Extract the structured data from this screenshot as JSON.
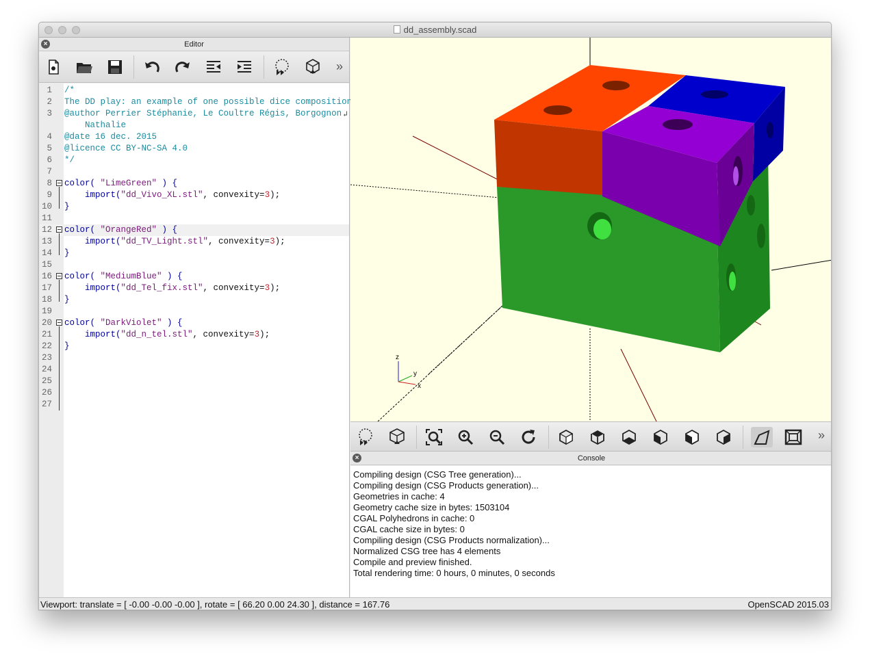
{
  "window": {
    "title": "dd_assembly.scad"
  },
  "editor": {
    "header": "Editor",
    "toolbar_icons": [
      "new-file-icon",
      "open-folder-icon",
      "save-icon",
      "undo-icon",
      "redo-icon",
      "unindent-icon",
      "indent-icon",
      "preview-icon",
      "render-icon",
      "more-icon"
    ],
    "lines": [
      {
        "n": "1",
        "segments": [
          {
            "t": "/*",
            "c": "comment"
          }
        ]
      },
      {
        "n": "2",
        "segments": [
          {
            "t": "The DD play: an example of one possible dice composition",
            "c": "comment"
          }
        ]
      },
      {
        "n": "3",
        "segments": [
          {
            "t": "@author Perrier Stéphanie, Le Coultre Régis, Borgognon",
            "c": "comment"
          }
        ]
      },
      {
        "n": "",
        "segments": [
          {
            "t": "    Nathalie",
            "c": "comment"
          }
        ]
      },
      {
        "n": "4",
        "segments": [
          {
            "t": "@date 16 dec. 2015",
            "c": "comment"
          }
        ]
      },
      {
        "n": "5",
        "segments": [
          {
            "t": "@licence CC BY-NC-SA 4.0",
            "c": "comment"
          }
        ]
      },
      {
        "n": "6",
        "segments": [
          {
            "t": "*/",
            "c": "comment"
          }
        ]
      },
      {
        "n": "7",
        "segments": []
      },
      {
        "n": "8",
        "fold": true,
        "segments": [
          {
            "t": "color( ",
            "c": "kw"
          },
          {
            "t": "\"LimeGreen\"",
            "c": "str"
          },
          {
            "t": " ) {",
            "c": "kw"
          }
        ]
      },
      {
        "n": "9",
        "segments": [
          {
            "t": "    import(",
            "c": "kw"
          },
          {
            "t": "\"dd_Vivo_XL.stl\"",
            "c": "str"
          },
          {
            "t": ", convexity=",
            "c": "plain"
          },
          {
            "t": "3",
            "c": "num"
          },
          {
            "t": ");",
            "c": "plain"
          }
        ]
      },
      {
        "n": "10",
        "segments": [
          {
            "t": "}",
            "c": "kw"
          }
        ]
      },
      {
        "n": "11",
        "segments": []
      },
      {
        "n": "12",
        "fold": true,
        "hl": true,
        "segments": [
          {
            "t": "color( ",
            "c": "kw"
          },
          {
            "t": "\"OrangeRed\"",
            "c": "str"
          },
          {
            "t": " ) {",
            "c": "kw"
          }
        ]
      },
      {
        "n": "13",
        "segments": [
          {
            "t": "    import(",
            "c": "kw"
          },
          {
            "t": "\"dd_TV_Light.stl\"",
            "c": "str"
          },
          {
            "t": ", convexity=",
            "c": "plain"
          },
          {
            "t": "3",
            "c": "num"
          },
          {
            "t": ");",
            "c": "plain"
          }
        ]
      },
      {
        "n": "14",
        "segments": [
          {
            "t": "}",
            "c": "kw"
          }
        ]
      },
      {
        "n": "15",
        "segments": []
      },
      {
        "n": "16",
        "fold": true,
        "segments": [
          {
            "t": "color( ",
            "c": "kw"
          },
          {
            "t": "\"MediumBlue\"",
            "c": "str"
          },
          {
            "t": " ) {",
            "c": "kw"
          }
        ]
      },
      {
        "n": "17",
        "segments": [
          {
            "t": "    import(",
            "c": "kw"
          },
          {
            "t": "\"dd_Tel_fix.stl\"",
            "c": "str"
          },
          {
            "t": ", convexity=",
            "c": "plain"
          },
          {
            "t": "3",
            "c": "num"
          },
          {
            "t": ");",
            "c": "plain"
          }
        ]
      },
      {
        "n": "18",
        "segments": [
          {
            "t": "}",
            "c": "kw"
          }
        ]
      },
      {
        "n": "19",
        "segments": []
      },
      {
        "n": "20",
        "fold": true,
        "segments": [
          {
            "t": "color( ",
            "c": "kw"
          },
          {
            "t": "\"DarkViolet\"",
            "c": "str"
          },
          {
            "t": " ) {",
            "c": "kw"
          }
        ]
      },
      {
        "n": "21",
        "segments": [
          {
            "t": "    import(",
            "c": "kw"
          },
          {
            "t": "\"dd_n_tel.stl\"",
            "c": "str"
          },
          {
            "t": ", convexity=",
            "c": "plain"
          },
          {
            "t": "3",
            "c": "num"
          },
          {
            "t": ");",
            "c": "plain"
          }
        ]
      },
      {
        "n": "22",
        "segments": [
          {
            "t": "}",
            "c": "kw"
          }
        ]
      },
      {
        "n": "23",
        "segments": []
      },
      {
        "n": "24",
        "segments": []
      },
      {
        "n": "25",
        "segments": []
      },
      {
        "n": "26",
        "segments": []
      },
      {
        "n": "27",
        "segments": []
      }
    ]
  },
  "viewport": {
    "background": "#ffffe5",
    "axis_labels": {
      "z": "z",
      "y": "y",
      "x": "x"
    },
    "colors": {
      "green": "#2a992a",
      "orange_red": "#ff4500",
      "medium_blue": "#0000cd",
      "dark_violet": "#9400d3"
    }
  },
  "view_toolbar_icons": [
    "preview-icon",
    "render-icon",
    "view-all-icon",
    "zoom-in-icon",
    "zoom-out-icon",
    "reset-view-icon",
    "view-right-icon",
    "view-top-icon",
    "view-bottom-icon",
    "view-left-icon",
    "view-front-icon",
    "view-back-icon",
    "perspective-icon",
    "orthogonal-icon",
    "more-icon"
  ],
  "console": {
    "header": "Console",
    "lines": [
      "Compiling design (CSG Tree generation)...",
      "Compiling design (CSG Products generation)...",
      "Geometries in cache: 4",
      "Geometry cache size in bytes: 1503104",
      "CGAL Polyhedrons in cache: 0",
      "CGAL cache size in bytes: 0",
      "Compiling design (CSG Products normalization)...",
      "Normalized CSG tree has 4 elements",
      "Compile and preview finished.",
      "Total rendering time: 0 hours, 0 minutes, 0 seconds"
    ]
  },
  "statusbar": {
    "viewport_info": "Viewport: translate = [ -0.00 -0.00 -0.00 ], rotate = [ 66.20 0.00 24.30 ], distance = 167.76",
    "version": "OpenSCAD 2015.03"
  }
}
